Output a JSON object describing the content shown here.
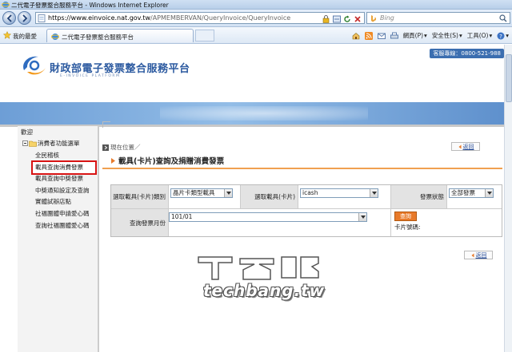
{
  "window": {
    "title": "二代電子發票整合服務平台 - Windows Internet Explorer"
  },
  "address_bar": {
    "url_host": "https://www.einvoice.nat.gov.tw",
    "url_path": "/APMEMBERVAN/QueryInvoice/QueryInvoice",
    "search_placeholder": "Bing"
  },
  "favorites_bar": {
    "favorites_label": "我的最愛",
    "tab_label": "二代電子發票整合服務平台",
    "commands": [
      {
        "label": "網頁(P)",
        "icon": "page-icon"
      },
      {
        "label": "安全性(S)",
        "icon": "safety-icon"
      },
      {
        "label": "工具(O)",
        "icon": "tools-icon"
      },
      {
        "label": "",
        "icon": "help-icon"
      }
    ]
  },
  "header": {
    "site_title": "財政部電子發票整合服務平台",
    "site_subtitle": "E-INVOICE PLATFORM",
    "hotline": "客服專線：0800-521-988"
  },
  "sidebar": {
    "welcome": "歡迎",
    "root_label": "消費者功能選單",
    "items": [
      {
        "label": "全民稽核",
        "active": false
      },
      {
        "label": "載具查詢消費發票",
        "active": true
      },
      {
        "label": "載具查詢中獎發票",
        "active": false
      },
      {
        "label": "中獎通知設定及查詢",
        "active": false
      },
      {
        "label": "實體試辦店點",
        "active": false
      },
      {
        "label": "社福團體申請愛心碼",
        "active": false
      },
      {
        "label": "查詢社福團體愛心碼",
        "active": false
      }
    ]
  },
  "main": {
    "breadcrumb": "現在位置／",
    "back_label": "返回",
    "page_title": "載具(卡片)查詢及捐贈消費發票",
    "form": {
      "carrier_type_label": "選取載具(卡片)類別",
      "carrier_type_value": "晶片卡類型載具",
      "carrier_label": "選取載具(卡片)",
      "carrier_value": "icash",
      "status_label": "發票狀態",
      "status_value": "全部發票",
      "month_label": "查詢發票月份",
      "month_value": "101/01",
      "query_button": "查詢",
      "card_number_label": "卡片號碼:"
    }
  },
  "watermark": {
    "text": "techbang.tw"
  },
  "colors": {
    "accent_orange": "#e87a2a",
    "highlight_red": "#d81313",
    "brand_blue": "#2c5aa0"
  }
}
